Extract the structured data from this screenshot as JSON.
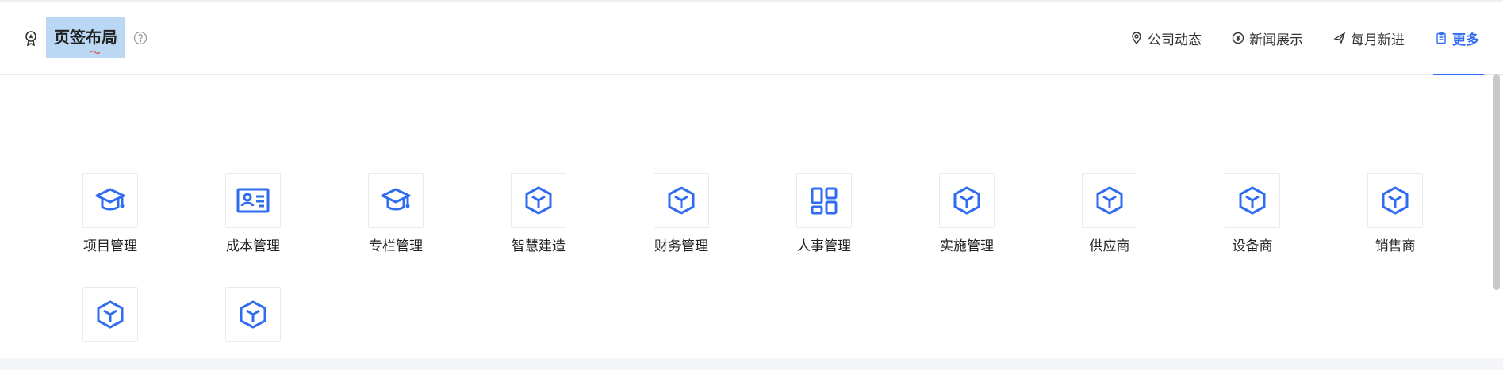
{
  "header": {
    "title": "页签布局",
    "tabs": [
      {
        "label": "公司动态",
        "icon": "location-pin-icon"
      },
      {
        "label": "新闻展示",
        "icon": "currency-circle-icon"
      },
      {
        "label": "每月新进",
        "icon": "airplane-icon"
      },
      {
        "label": "更多",
        "icon": "clipboard-icon",
        "active": true
      }
    ]
  },
  "colors": {
    "accent": "#2f6cf0",
    "title_highlight": "#bad7f3",
    "border": "#e6e8eb"
  },
  "apps": [
    {
      "label": "项目管理",
      "icon": "graduation-cap-icon"
    },
    {
      "label": "成本管理",
      "icon": "id-card-icon"
    },
    {
      "label": "专栏管理",
      "icon": "graduation-cap-icon"
    },
    {
      "label": "智慧建造",
      "icon": "cube-icon"
    },
    {
      "label": "财务管理",
      "icon": "cube-icon"
    },
    {
      "label": "人事管理",
      "icon": "dashboard-grid-icon"
    },
    {
      "label": "实施管理",
      "icon": "cube-icon"
    },
    {
      "label": "供应商",
      "icon": "cube-icon"
    },
    {
      "label": "设备商",
      "icon": "cube-icon"
    },
    {
      "label": "销售商",
      "icon": "cube-icon"
    },
    {
      "label": "",
      "icon": "cube-icon"
    },
    {
      "label": "",
      "icon": "cube-icon"
    }
  ]
}
